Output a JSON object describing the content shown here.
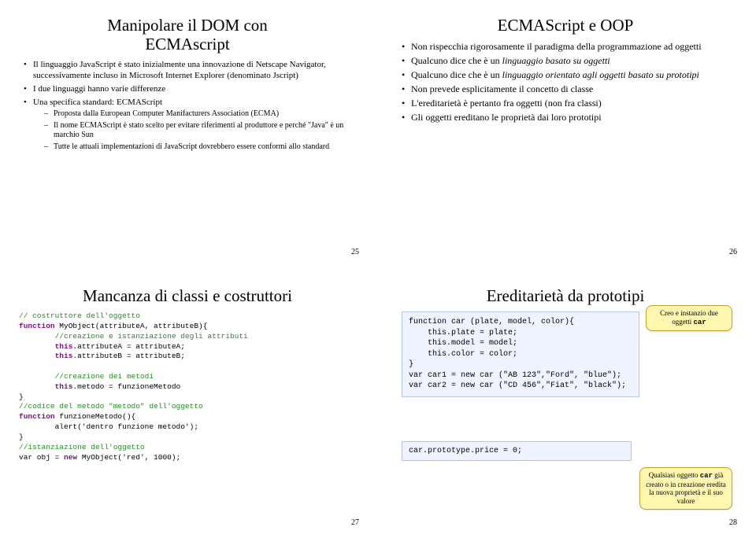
{
  "slide25": {
    "title": "Manipolare il DOM con\nECMAscript",
    "bullets": [
      "Il linguaggio JavaScript è stato inizialmente una innovazione di Netscape Navigator, successivamente incluso in Microsoft Internet Explorer (denominato Jscript)",
      "I due linguaggi hanno varie differenze",
      "Una specifica standard: ECMAScript"
    ],
    "subbullets": [
      "Proposta dalla European Computer Manifacturers Association (ECMA)",
      "Il nome ECMAScript è stato scelto per evitare riferimenti al produttore e perché \"Java\" è un marchio Sun",
      "Tutte le attuali implementazioni di JavaScript dovrebbero essere conformi allo standard"
    ],
    "page": "25"
  },
  "slide26": {
    "title": "ECMAScript e OOP",
    "b1": "Non rispecchia rigorosamente il paradigma della programmazione ad oggetti",
    "b2a": "Qualcuno dice che è un ",
    "b2b": "linguaggio basato su oggetti",
    "b3a": "Qualcuno dice che è un ",
    "b3b": "linguaggio orientato agli oggetti basato su prototipi",
    "b4": "Non prevede esplicitamente il concetto di classe",
    "b5": "L'ereditarietà è pertanto fra oggetti (non fra classi)",
    "b6": "Gli oggetti ereditano le proprietà dai loro prototipi",
    "page": "26"
  },
  "slide27": {
    "title": "Mancanza di classi e costruttori",
    "code": {
      "l1": "// costruttore dell'oggetto",
      "l2a": "function",
      "l2b": " MyObject(attributeA, attributeB){",
      "l3": "        //creazione e istanziazione degli attributi",
      "l4a": "        ",
      "l4b": "this",
      "l4c": ".attributeA = attributeA;",
      "l5a": "        ",
      "l5b": "this",
      "l5c": ".attributeB = attributeB;",
      "l6": "",
      "l7": "        //creazione dei metodi",
      "l8a": "        ",
      "l8b": "this",
      "l8c": ".metodo = funzioneMetodo",
      "l9": "}",
      "l10": "//codice del metodo \"metodo\" dell'oggetto",
      "l11a": "function",
      "l11b": " funzioneMetodo(){",
      "l12": "        alert('dentro funzione metodo');",
      "l13": "}",
      "l14": "//istanziazione dell'oggetto",
      "l15a": "var obj = ",
      "l15b": "new",
      "l15c": " MyObject('red', 1000);"
    },
    "page": "27"
  },
  "slide28": {
    "title": "Ereditarietà da prototipi",
    "box1": "function car (plate, model, color){\n    this.plate = plate;\n    this.model = model;\n    this.color = color;\n}\nvar car1 = new car (\"AB 123\",\"Ford\", \"blue\");\nvar car2 = new car (\"CD 456\",\"Fiat\", \"black\");",
    "box2": "car.prototype.price = 0;",
    "note1a": "Creo e instanzio due oggetti ",
    "note1b": "car",
    "note2a": "Qualsiasi oggetto ",
    "note2b": "car",
    "note2c": " già creato o in creazione eredita la nuova proprietà e il suo valore",
    "page": "28"
  }
}
